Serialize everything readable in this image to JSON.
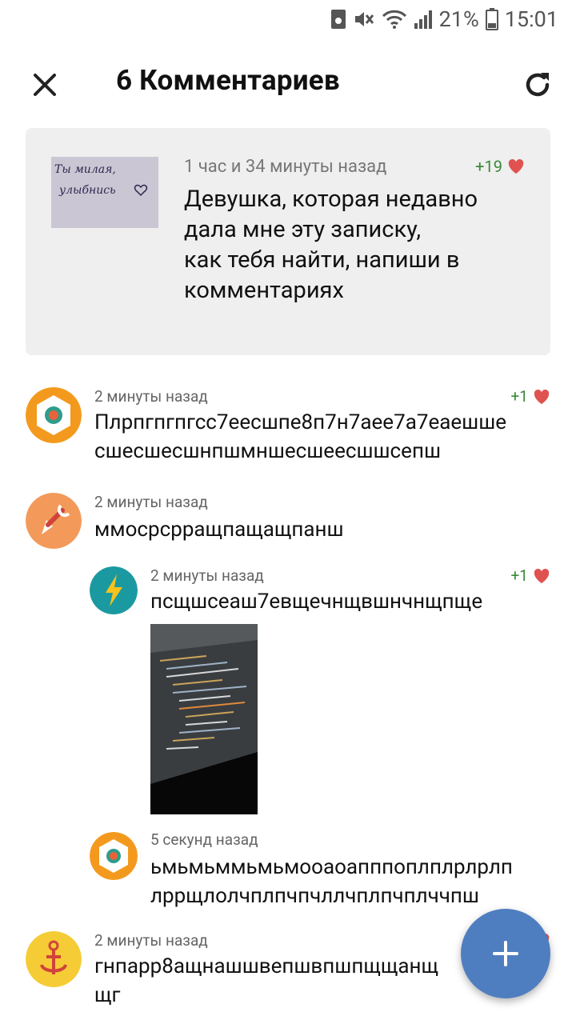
{
  "status_bar": {
    "battery_percent": "21%",
    "time": "15:01",
    "icons": [
      "storage-icon",
      "mute-icon",
      "wifi-icon",
      "signal-icon",
      "battery-icon"
    ]
  },
  "header": {
    "title": "6 Комментариев",
    "close_icon": "close-icon",
    "refresh_icon": "refresh-icon"
  },
  "post": {
    "time": "1 час и 34 минуты назад",
    "likes": "+19",
    "text_lines": [
      "Девушка, которая недавно",
      "дала мне эту записку,",
      "как тебя найти, напиши в",
      "комментариях"
    ],
    "note_image_lines": [
      "Ты милая,",
      "улыбнись"
    ]
  },
  "comments": [
    {
      "time": "2 минуты назад",
      "likes": "+1",
      "lines": [
        "Плрпгпгпгсс7еесшпе8п7н7аее7а7еаешше",
        "сшесшесшнпшмншесшеесшшсепш"
      ]
    },
    {
      "time": "2 минуты назад",
      "lines": [
        "ммосрсрращпащащпанш"
      ]
    },
    {
      "time": "2 минуты назад",
      "likes": "+1",
      "lines": [
        "псщшсеаш7евщечнщвшнчнщпще"
      ]
    },
    {
      "time": "5 секунд назад",
      "lines": [
        "ьмьмьммьмьмооаоапппоплплрлрлп",
        "лррщлолчплпчпчллчплпчплччпш"
      ]
    },
    {
      "time": "2 минуты назад",
      "likes": "+1",
      "lines": [
        "гнпарр8ащнашшвепшвпшпщщанщ",
        "щг"
      ]
    }
  ],
  "colors": {
    "accent_blue": "#4f7ec0",
    "like_green": "#3a8a3a",
    "heart_red": "#e0524f",
    "card_bg": "#efefef"
  }
}
